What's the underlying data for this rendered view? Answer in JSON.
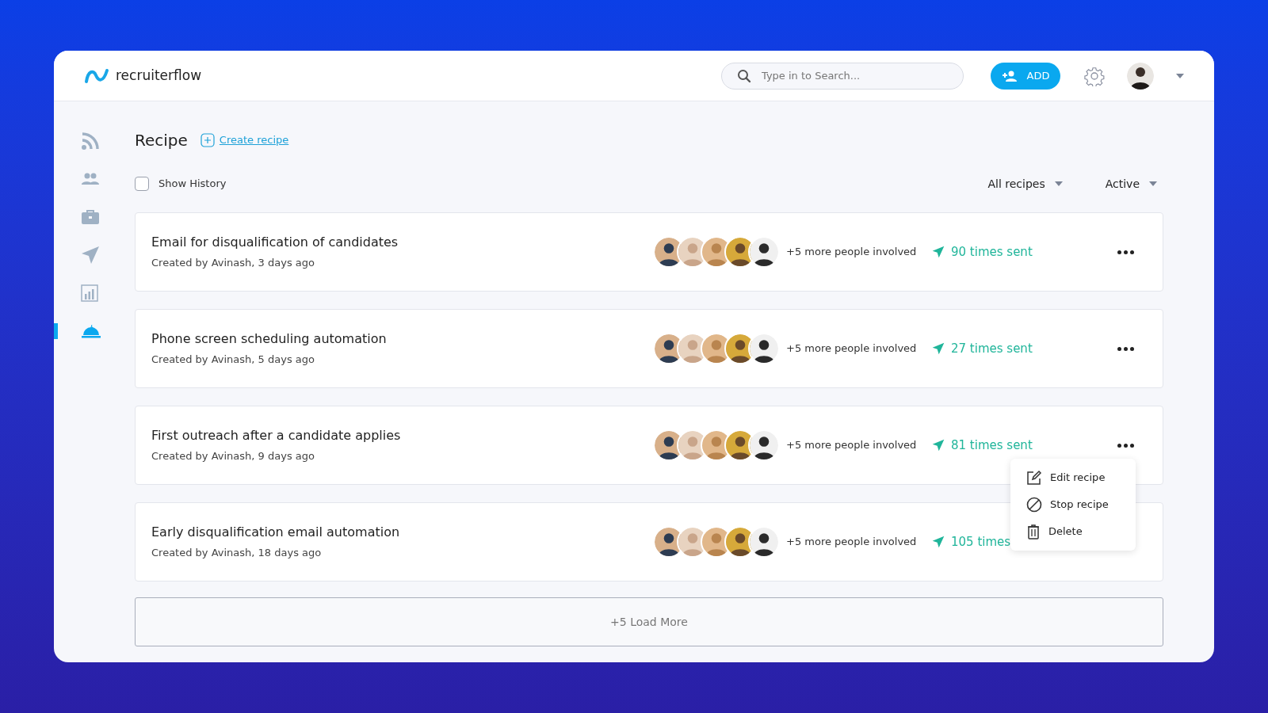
{
  "header": {
    "logo_text": "recruiterflow",
    "search": {
      "placeholder": "Type in to Search..."
    },
    "add_button": "ADD"
  },
  "sidebar": {
    "items": [
      {
        "kind": "feed",
        "selected": false
      },
      {
        "kind": "people",
        "selected": false
      },
      {
        "kind": "jobs",
        "selected": false
      },
      {
        "kind": "send",
        "selected": false
      },
      {
        "kind": "reports",
        "selected": false
      },
      {
        "kind": "recipes",
        "selected": true
      }
    ]
  },
  "page": {
    "title": "Recipe",
    "create_link": "Create recipe",
    "show_history": {
      "label": "Show History",
      "checked": false
    },
    "filters": [
      "All recipes",
      "Active"
    ]
  },
  "recipes": [
    {
      "title": "Email for disqualification of candidates",
      "subtitle": "Created by Avinash, 3 days ago",
      "people": "+5 more people involved",
      "sent": "90 times sent",
      "menu_open": false
    },
    {
      "title": "Phone screen scheduling automation",
      "subtitle": "Created by Avinash, 5 days ago",
      "people": "+5 more people involved",
      "sent": "27 times sent",
      "menu_open": false
    },
    {
      "title": "First outreach after a candidate applies",
      "subtitle": "Created by Avinash, 9 days ago",
      "people": "+5 more people involved",
      "sent": "81 times sent",
      "menu_open": true
    },
    {
      "title": "Early disqualification email automation",
      "subtitle": "Created by Avinash, 18 days ago",
      "people": "+5 more people involved",
      "sent": "105 times",
      "menu_open": false
    }
  ],
  "context_menu": {
    "items": [
      {
        "kind": "edit",
        "label": "Edit recipe"
      },
      {
        "kind": "stop",
        "label": "Stop recipe"
      },
      {
        "kind": "delete",
        "label": "Delete"
      }
    ]
  },
  "load_more": "+5 Load More"
}
